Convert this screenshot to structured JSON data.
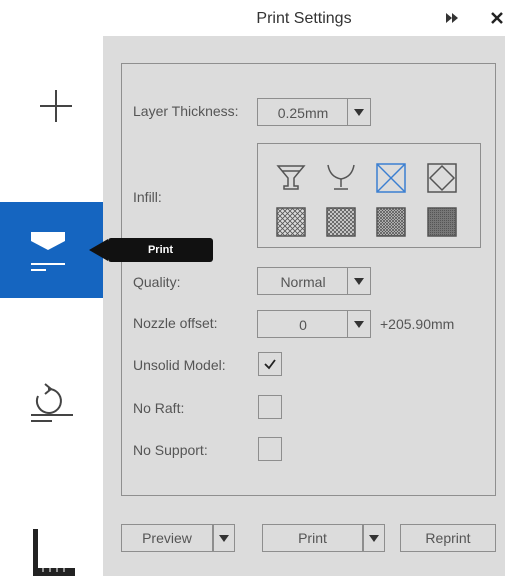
{
  "window": {
    "title": "Print Settings"
  },
  "toolbar": {
    "items": [
      {
        "name": "add",
        "icon": "plus-icon",
        "active": false
      },
      {
        "name": "print",
        "icon": "print-icon",
        "active": true
      },
      {
        "name": "rotate",
        "icon": "rotate-icon",
        "active": false
      },
      {
        "name": "measure",
        "icon": "ruler-icon",
        "active": false
      }
    ],
    "tooltip": "Print",
    "active_color": "#1565c0"
  },
  "settings": {
    "layer_thickness": {
      "label": "Layer Thickness:",
      "value": "0.25mm"
    },
    "infill": {
      "label": "Infill:",
      "selected_index": 2,
      "options": [
        "hollow-cup-icon",
        "shell-cup-icon",
        "sparse-infill-icon",
        "diamond-infill-icon",
        "crosshatch-low-icon",
        "crosshatch-medium-icon",
        "crosshatch-high-icon",
        "solid-infill-icon"
      ]
    },
    "quality": {
      "label": "Quality:",
      "value": "Normal"
    },
    "nozzle_offset": {
      "label": "Nozzle offset:",
      "value": "0",
      "extra": "+205.90mm"
    },
    "unsolid_model": {
      "label": "Unsolid Model:",
      "checked": true
    },
    "no_raft": {
      "label": "No Raft:",
      "checked": false
    },
    "no_support": {
      "label": "No Support:",
      "checked": false
    }
  },
  "footer": {
    "preview_label": "Preview",
    "print_label": "Print",
    "reprint_label": "Reprint"
  },
  "colors": {
    "panel_bg": "#dcdcdc",
    "accent": "#1565c0",
    "selected_icon": "#3b7fd1"
  }
}
